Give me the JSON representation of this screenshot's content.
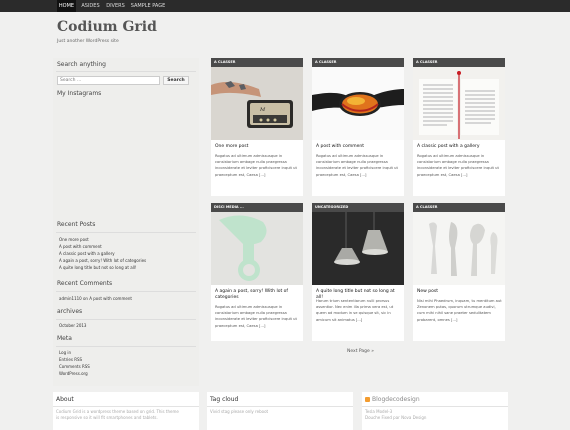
{
  "nav": {
    "items": [
      "HOME",
      "ASIDES",
      "DIVERS",
      "SAMPLE PAGE"
    ]
  },
  "site": {
    "title": "Codium Grid",
    "description": "Just another WordPress site"
  },
  "sidebar": {
    "search_title": "Search anything",
    "search_placeholder": "Search …",
    "search_button": "Search",
    "instagram_title": "My Instagrams",
    "recent_posts_title": "Recent Posts",
    "recent_posts": [
      "One more post",
      "A post with comment",
      "A classic post with a gallery",
      "A again a post, sorry! With lot of categories",
      "A quite long title but not so long at all!"
    ],
    "recent_comments_title": "Recent Comments",
    "recent_comment": "admin1110 on A post with comment",
    "archives_title": "archives",
    "archive": "October 2013",
    "meta_title": "Meta",
    "meta_links": [
      "Log in",
      "Entries RSS",
      "Comments RSS",
      "WordPress.org"
    ]
  },
  "posts": [
    {
      "category": "A CLASSER",
      "image_icon": "speaker-arm-photo",
      "title": "One more post",
      "excerpt": "Rogatus ad ultimum admissusque in consistorium ambage nulla praegressa inconsiderate et leviter proficiscere inquit ut praeceptum est, Caesa [...]"
    },
    {
      "category": "A CLASSER",
      "image_icon": "ski-goggles-photo",
      "title": "A post with comment",
      "excerpt": "Rogatus ad ultimum admissusque in consistorium ambage nulla praegressa inconsiderate et leviter proficiscere inquit ut praeceptum est, Caesa [...]"
    },
    {
      "category": "A CLASSER",
      "image_icon": "open-book-photo",
      "title": "A classic post with a gallery",
      "excerpt": "Rogatus ad ultimum admissusque in consistorium ambage nulla praegressa inconsiderate et leviter proficiscere inquit ut praeceptum est, Caesa [...]"
    },
    {
      "category": "DISCI MEDIA  ...",
      "image_icon": "green-object-photo",
      "title": "A again a post, sorry! With lot of categories",
      "excerpt": "Rogatus ad ultimum admissusque in consistorium ambage nulla praegressa inconsiderate et leviter proficiscere inquit ut praeceptum est, Caesa [...]"
    },
    {
      "category": "UNCATEGORIZED",
      "image_icon": "pendant-lamps-photo",
      "title": "A quite long title but not so long at all!",
      "excerpt": "Harum trium sententiarum nulli prorsus assentior. Nec enim illa prima vera est, ut quem ad modum in se quisque sit, sic in amicum sit animatus [...]"
    },
    {
      "category": "A CLASSER",
      "image_icon": "cutlery-photo",
      "title": "New post",
      "excerpt": "Nisi mihi Phaedrum, inquam, tu mentitum aut Zenonem putas, quorum utrumque audivi, cum mihi nihil sane praeter sedulitatem probarent, omnes [...]"
    }
  ],
  "pagination": {
    "next": "Next Page »"
  },
  "footer": {
    "about_title": "About",
    "about_text_1": "Codium Grid is a wordpress theme based on grid. This theme",
    "about_text_2": "is responsive so it will fit smartphones and tablets.",
    "tags_title": "Tag cloud",
    "tags_text": "Vivid stag please only reboot",
    "blog_title": "Blogdecodesign",
    "blog_items": [
      "Tesla Model-3",
      "Douche Fixed par Nova Design"
    ]
  }
}
